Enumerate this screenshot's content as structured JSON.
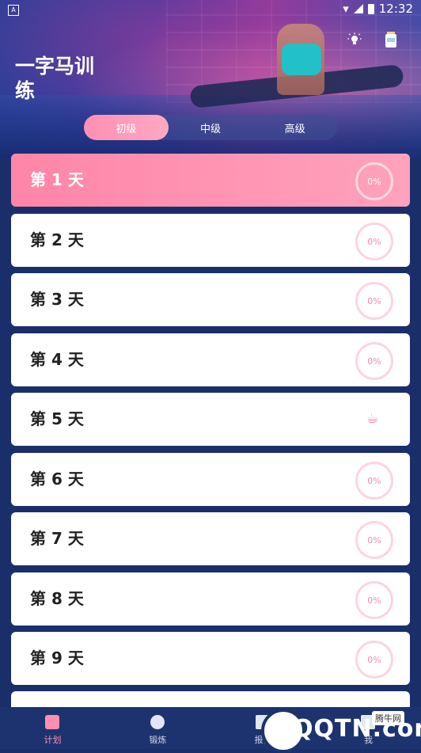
{
  "statusbar": {
    "time": "12:32",
    "left_icon": "A"
  },
  "header": {
    "title": "一字马训练",
    "icons": [
      "lightbulb-icon",
      "jar-icon"
    ]
  },
  "levels": [
    {
      "label": "初级",
      "active": true
    },
    {
      "label": "中级",
      "active": false
    },
    {
      "label": "高级",
      "active": false
    }
  ],
  "days": [
    {
      "label": "第 1 天",
      "progress": "0%",
      "rest": false,
      "active": true
    },
    {
      "label": "第 2 天",
      "progress": "0%",
      "rest": false,
      "active": false
    },
    {
      "label": "第 3 天",
      "progress": "0%",
      "rest": false,
      "active": false
    },
    {
      "label": "第 4 天",
      "progress": "0%",
      "rest": false,
      "active": false
    },
    {
      "label": "第 5 天",
      "progress": "",
      "rest": true,
      "active": false
    },
    {
      "label": "第 6 天",
      "progress": "0%",
      "rest": false,
      "active": false
    },
    {
      "label": "第 7 天",
      "progress": "0%",
      "rest": false,
      "active": false
    },
    {
      "label": "第 8 天",
      "progress": "0%",
      "rest": false,
      "active": false
    },
    {
      "label": "第 9 天",
      "progress": "0%",
      "rest": false,
      "active": false
    }
  ],
  "tabs": [
    {
      "label": "计划",
      "icon": "plan-icon",
      "active": true
    },
    {
      "label": "锻炼",
      "icon": "compass-icon",
      "active": false
    },
    {
      "label": "报告",
      "icon": "report-icon",
      "active": false
    },
    {
      "label": "我",
      "icon": "profile-icon",
      "active": false
    }
  ],
  "watermark": {
    "text": "QQTN.com",
    "badge": "腾牛网"
  },
  "colors": {
    "accent": "#ff8fb0",
    "background": "#1a2f6a",
    "tabbar": "#1d336f"
  }
}
